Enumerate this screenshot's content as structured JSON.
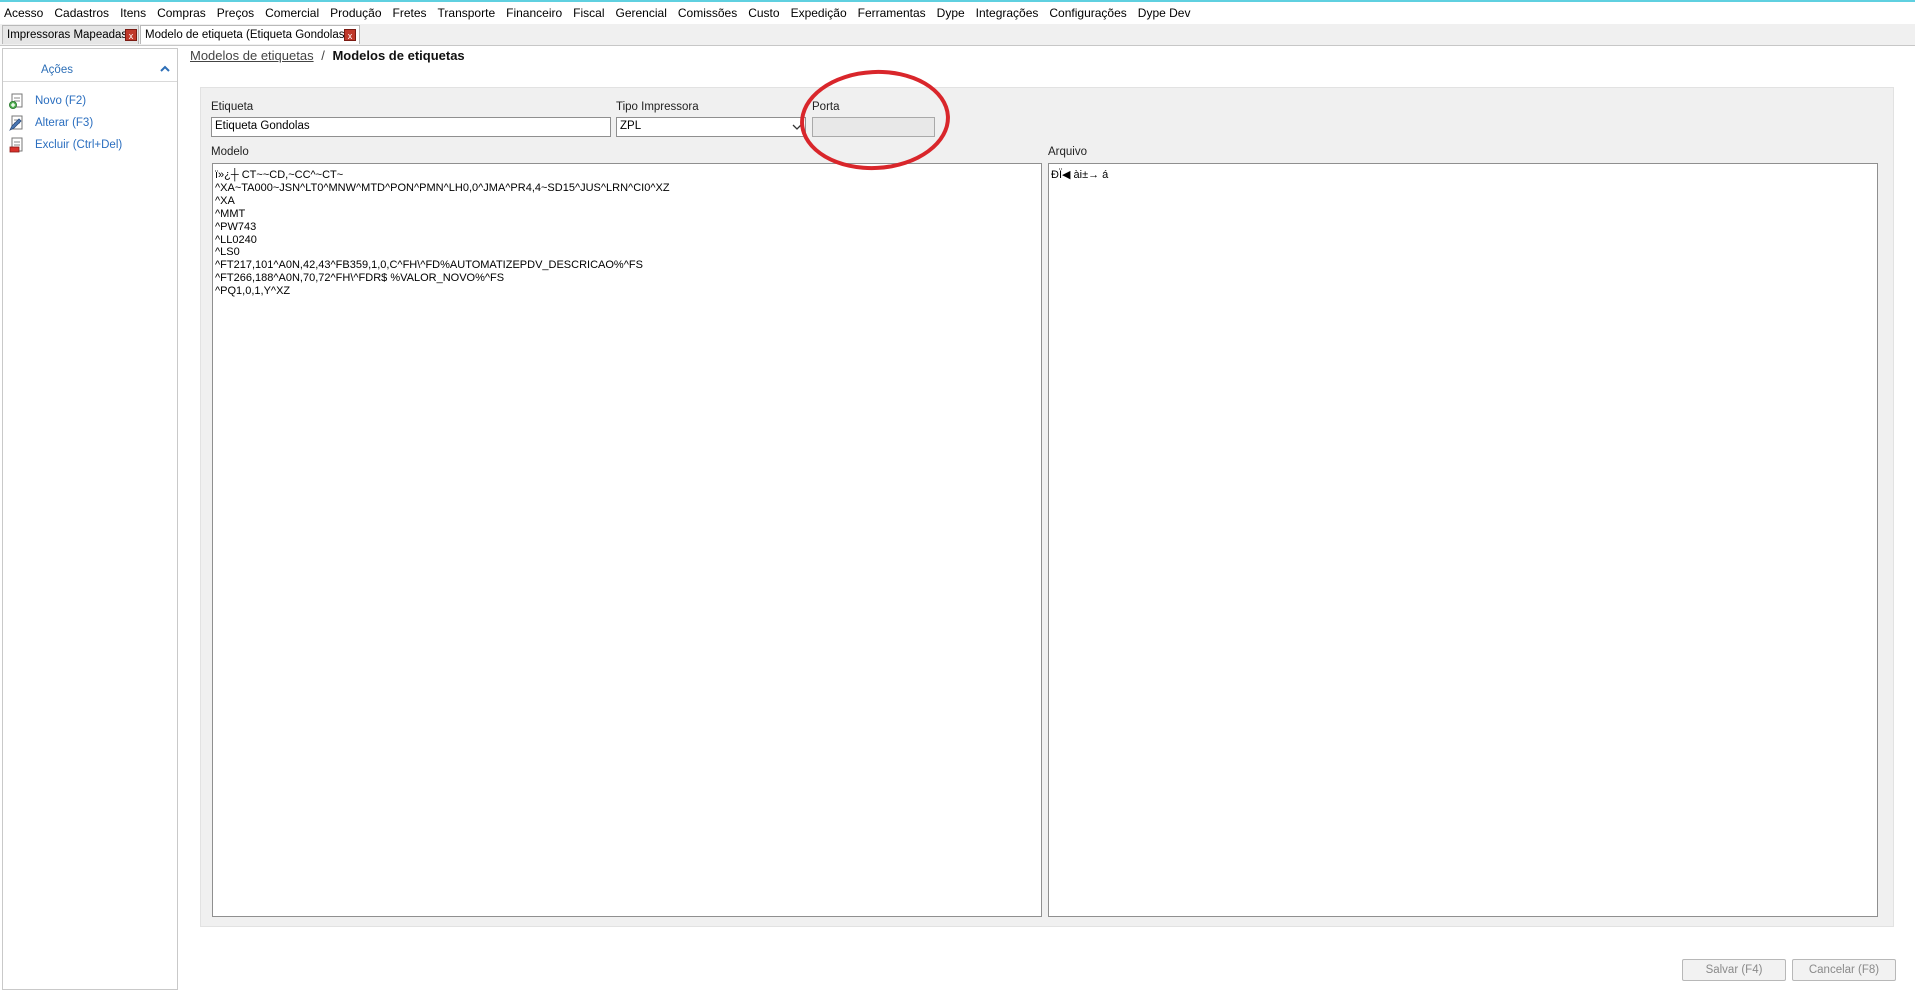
{
  "menu": [
    "Acesso",
    "Cadastros",
    "Itens",
    "Compras",
    "Preços",
    "Comercial",
    "Produção",
    "Fretes",
    "Transporte",
    "Financeiro",
    "Fiscal",
    "Gerencial",
    "Comissões",
    "Custo",
    "Expedição",
    "Ferramentas",
    "Dype",
    "Integrações",
    "Configurações",
    "Dype Dev"
  ],
  "tabs": [
    {
      "label": "Impressoras Mapeadas",
      "close": "x"
    },
    {
      "label": "Modelo de etiqueta (Etiqueta Gondolas)",
      "close": "x"
    }
  ],
  "sidebar": {
    "title": "Ações",
    "actions": [
      {
        "label": "Novo (F2)",
        "icon": "new-document-icon"
      },
      {
        "label": "Alterar (F3)",
        "icon": "edit-document-icon"
      },
      {
        "label": "Excluir (Ctrl+Del)",
        "icon": "delete-document-icon"
      }
    ]
  },
  "breadcrumb": {
    "link": "Modelos de etiquetas",
    "separator": "/",
    "current": "Modelos de etiquetas"
  },
  "form": {
    "etiqueta": {
      "label": "Etiqueta",
      "value": "Etiqueta Gondolas"
    },
    "tipo_impressora": {
      "label": "Tipo Impressora",
      "value": "ZPL"
    },
    "porta": {
      "label": "Porta",
      "value": ""
    },
    "modelo": {
      "label": "Modelo",
      "lines": [
        "ï»¿┼ CT~~CD,~CC^~CT~",
        "^XA~TA000~JSN^LT0^MNW^MTD^PON^PMN^LH0,0^JMA^PR4,4~SD15^JUS^LRN^CI0^XZ",
        "^XA",
        "^MMT",
        "^PW743",
        "^LL0240",
        "^LS0",
        "^FT217,101^A0N,42,43^FB359,1,0,C^FH\\^FD%AUTOMATIZEPDV_DESCRICAO%^FS",
        "^FT266,188^A0N,70,72^FH\\^FDR$ %VALOR_NOVO%^FS",
        "^PQ1,0,1,Y^XZ"
      ]
    },
    "arquivo": {
      "label": "Arquivo",
      "value": "ÐÏ◀ ài±→ á"
    }
  },
  "buttons": {
    "save": "Salvar (F4)",
    "cancel": "Cancelar (F8)"
  },
  "colors": {
    "accent": "#2a6ebf",
    "highlight": "#d9262b",
    "close": "#c0392b"
  }
}
